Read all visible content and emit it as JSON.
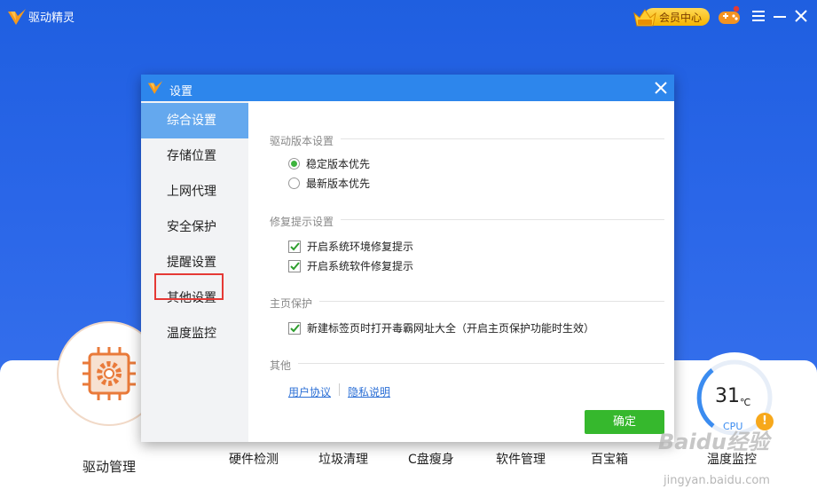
{
  "app": {
    "title": "驱动精灵"
  },
  "header": {
    "vip_label": "会员中心"
  },
  "dialog": {
    "title": "设置",
    "nav": [
      {
        "label": "综合设置",
        "active": true
      },
      {
        "label": "存储位置"
      },
      {
        "label": "上网代理"
      },
      {
        "label": "安全保护"
      },
      {
        "label": "提醒设置",
        "highlighted": true
      },
      {
        "label": "其他设置"
      },
      {
        "label": "温度监控"
      }
    ],
    "sections": {
      "version": {
        "title": "驱动版本设置",
        "options": [
          {
            "label": "稳定版本优先",
            "selected": true
          },
          {
            "label": "最新版本优先",
            "selected": false
          }
        ]
      },
      "repair": {
        "title": "修复提示设置",
        "options": [
          {
            "label": "开启系统环境修复提示",
            "checked": true
          },
          {
            "label": "开启系统软件修复提示",
            "checked": true
          }
        ]
      },
      "homepage": {
        "title": "主页保护",
        "options": [
          {
            "label": "新建标签页时打开毒霸网址大全（开启主页保护功能时生效）",
            "checked": true
          }
        ]
      },
      "other": {
        "title": "其他",
        "links": [
          "用户协议",
          "隐私说明"
        ]
      }
    },
    "ok_label": "确定"
  },
  "bottom": {
    "driver_label": "驱动管理",
    "tools": [
      "硬件检测",
      "垃圾清理",
      "C盘瘦身",
      "软件管理",
      "百宝箱"
    ],
    "temperature": {
      "value": "31",
      "unit": "℃",
      "sensor": "CPU",
      "label": "温度监控",
      "warning": "!"
    }
  },
  "watermark": {
    "main": "Baidu经验",
    "sub": "jingyan.baidu.com"
  },
  "colors": {
    "accent": "#2d86ec",
    "nav_active": "#64a8ee",
    "ok_button": "#36b82d",
    "highlight": "#e53935",
    "vip": "#f5b400"
  }
}
